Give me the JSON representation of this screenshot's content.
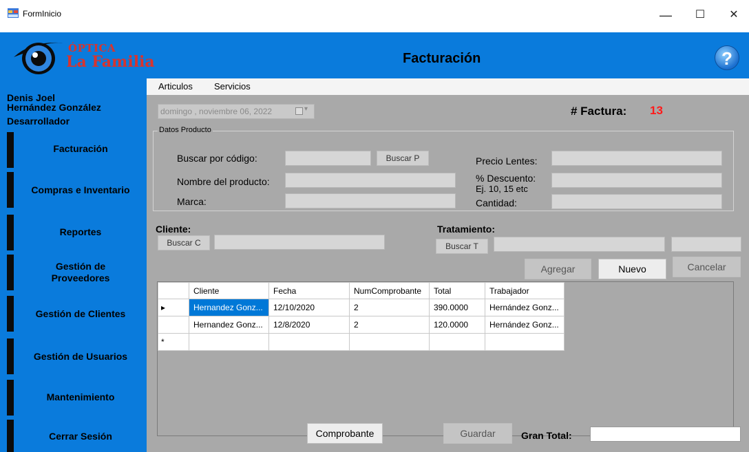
{
  "window": {
    "title": "FormInicio",
    "minimize": "—",
    "maximize": "☐",
    "close": "✕"
  },
  "header": {
    "logo_line1": "ÓPTICA",
    "logo_line2": "La Familia",
    "title": "Facturación",
    "help": "?"
  },
  "sidebar": {
    "user": [
      "Denis Joel",
      "Hernández González",
      "Desarrollador"
    ],
    "items": [
      {
        "label": "Facturación"
      },
      {
        "label": "Compras e Inventario"
      },
      {
        "label": "Reportes"
      },
      {
        "label": "Gestión de\nProveedores"
      },
      {
        "label": "Gestión de Clientes"
      },
      {
        "label": "Gestión de Usuarios"
      },
      {
        "label": "Mantenimiento"
      },
      {
        "label": "Cerrar Sesión"
      }
    ]
  },
  "menu": {
    "items": [
      "Articulos",
      "Servicios"
    ]
  },
  "date": {
    "value": "domingo , noviembre 06, 2022",
    "dropdown": "▾"
  },
  "invoice": {
    "label": "# Factura:",
    "number": "13"
  },
  "producto": {
    "legend": "Datos Producto",
    "buscar_codigo_label": "Buscar por código:",
    "buscar_codigo_value": "",
    "buscar_p_button": "Buscar P",
    "nombre_label": "Nombre del producto:",
    "nombre_value": "",
    "marca_label": "Marca:",
    "marca_value": "",
    "precio_label": "Precio Lentes:",
    "precio_value": "",
    "descuento_label": "% Descuento:",
    "descuento_hint": "Ej. 10, 15 etc",
    "descuento_value": "",
    "cantidad_label": "Cantidad:",
    "cantidad_value": ""
  },
  "cliente": {
    "label": "Cliente:",
    "button": "Buscar C",
    "value": ""
  },
  "tratamiento": {
    "label": "Tratamiento:",
    "button": "Buscar T",
    "value": "",
    "extra_value": ""
  },
  "actions": {
    "agregar": "Agregar",
    "nuevo": "Nuevo",
    "cancelar": "Cancelar",
    "comprobante": "Comprobante",
    "guardar": "Guardar"
  },
  "grid": {
    "columns": [
      "Cliente",
      "Fecha",
      "NumComprobante",
      "Total",
      "Trabajador"
    ],
    "rows": [
      {
        "marker": "▸",
        "cells": [
          "Hernandez Gonz...",
          "12/10/2020",
          "2",
          "390.0000",
          "Hernández Gonz..."
        ]
      },
      {
        "marker": "",
        "cells": [
          "Hernandez Gonz...",
          "12/8/2020",
          "2",
          "120.0000",
          "Hernández Gonz..."
        ]
      },
      {
        "marker": "*",
        "cells": [
          "",
          "",
          "",
          "",
          ""
        ]
      }
    ]
  },
  "totals": {
    "label": "Gran Total:",
    "value": ""
  }
}
